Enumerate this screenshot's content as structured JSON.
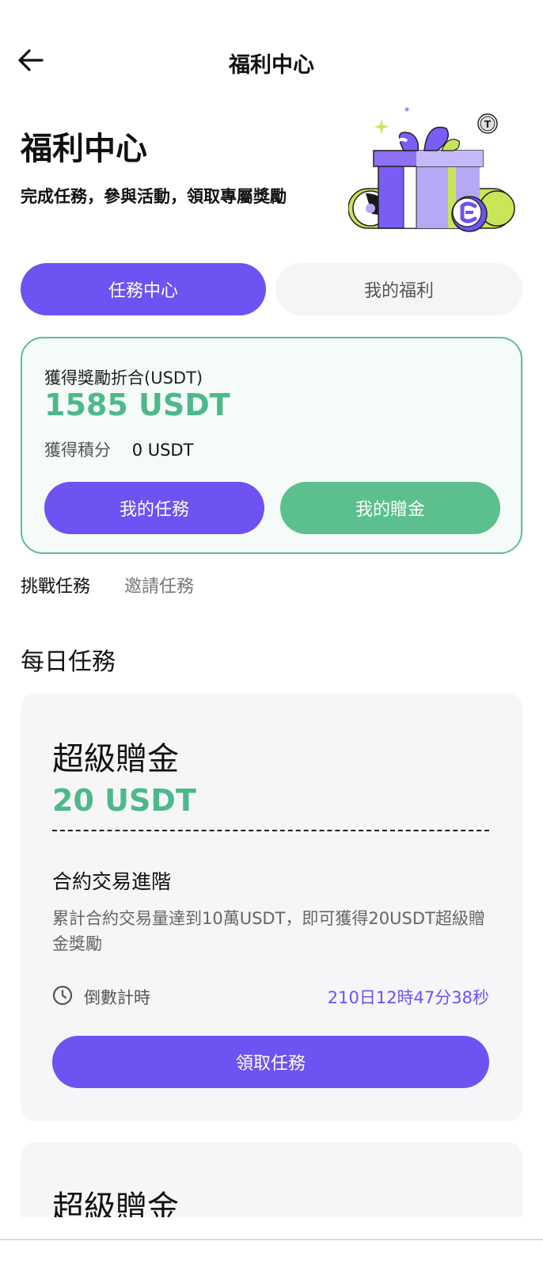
{
  "header": {
    "title": "福利中心",
    "back_icon": "arrow-left-icon"
  },
  "hero": {
    "title": "福利中心",
    "subtitle": "完成任務，參與活動，領取專屬獎勵",
    "illustration": "gift-box-illustration"
  },
  "segments": [
    {
      "label": "任務中心",
      "active": true
    },
    {
      "label": "我的福利",
      "active": false
    }
  ],
  "summary": {
    "label": "獲得獎勵折合(USDT)",
    "amount": "1585 USDT",
    "points_label": "獲得積分",
    "points_value": "0 USDT",
    "my_tasks_button": "我的任務",
    "my_bonus_button": "我的贈金"
  },
  "tabs": [
    {
      "label": "挑戰任務",
      "active": true
    },
    {
      "label": "邀請任務",
      "active": false
    }
  ],
  "section": {
    "title": "每日任務"
  },
  "tasks": [
    {
      "name": "超級贈金",
      "reward": "20 USDT",
      "subtitle": "合約交易進階",
      "description": "累計合約交易量達到10萬USDT，即可獲得20USDT超級贈金獎勵",
      "countdown_label": "倒數計時",
      "countdown_value": "210日12時47分38秒",
      "button": "領取任務"
    },
    {
      "name": "超級贈金"
    }
  ],
  "colors": {
    "primary": "#6e52f2",
    "green": "#4db98a",
    "green_button": "#5cbf8e"
  }
}
